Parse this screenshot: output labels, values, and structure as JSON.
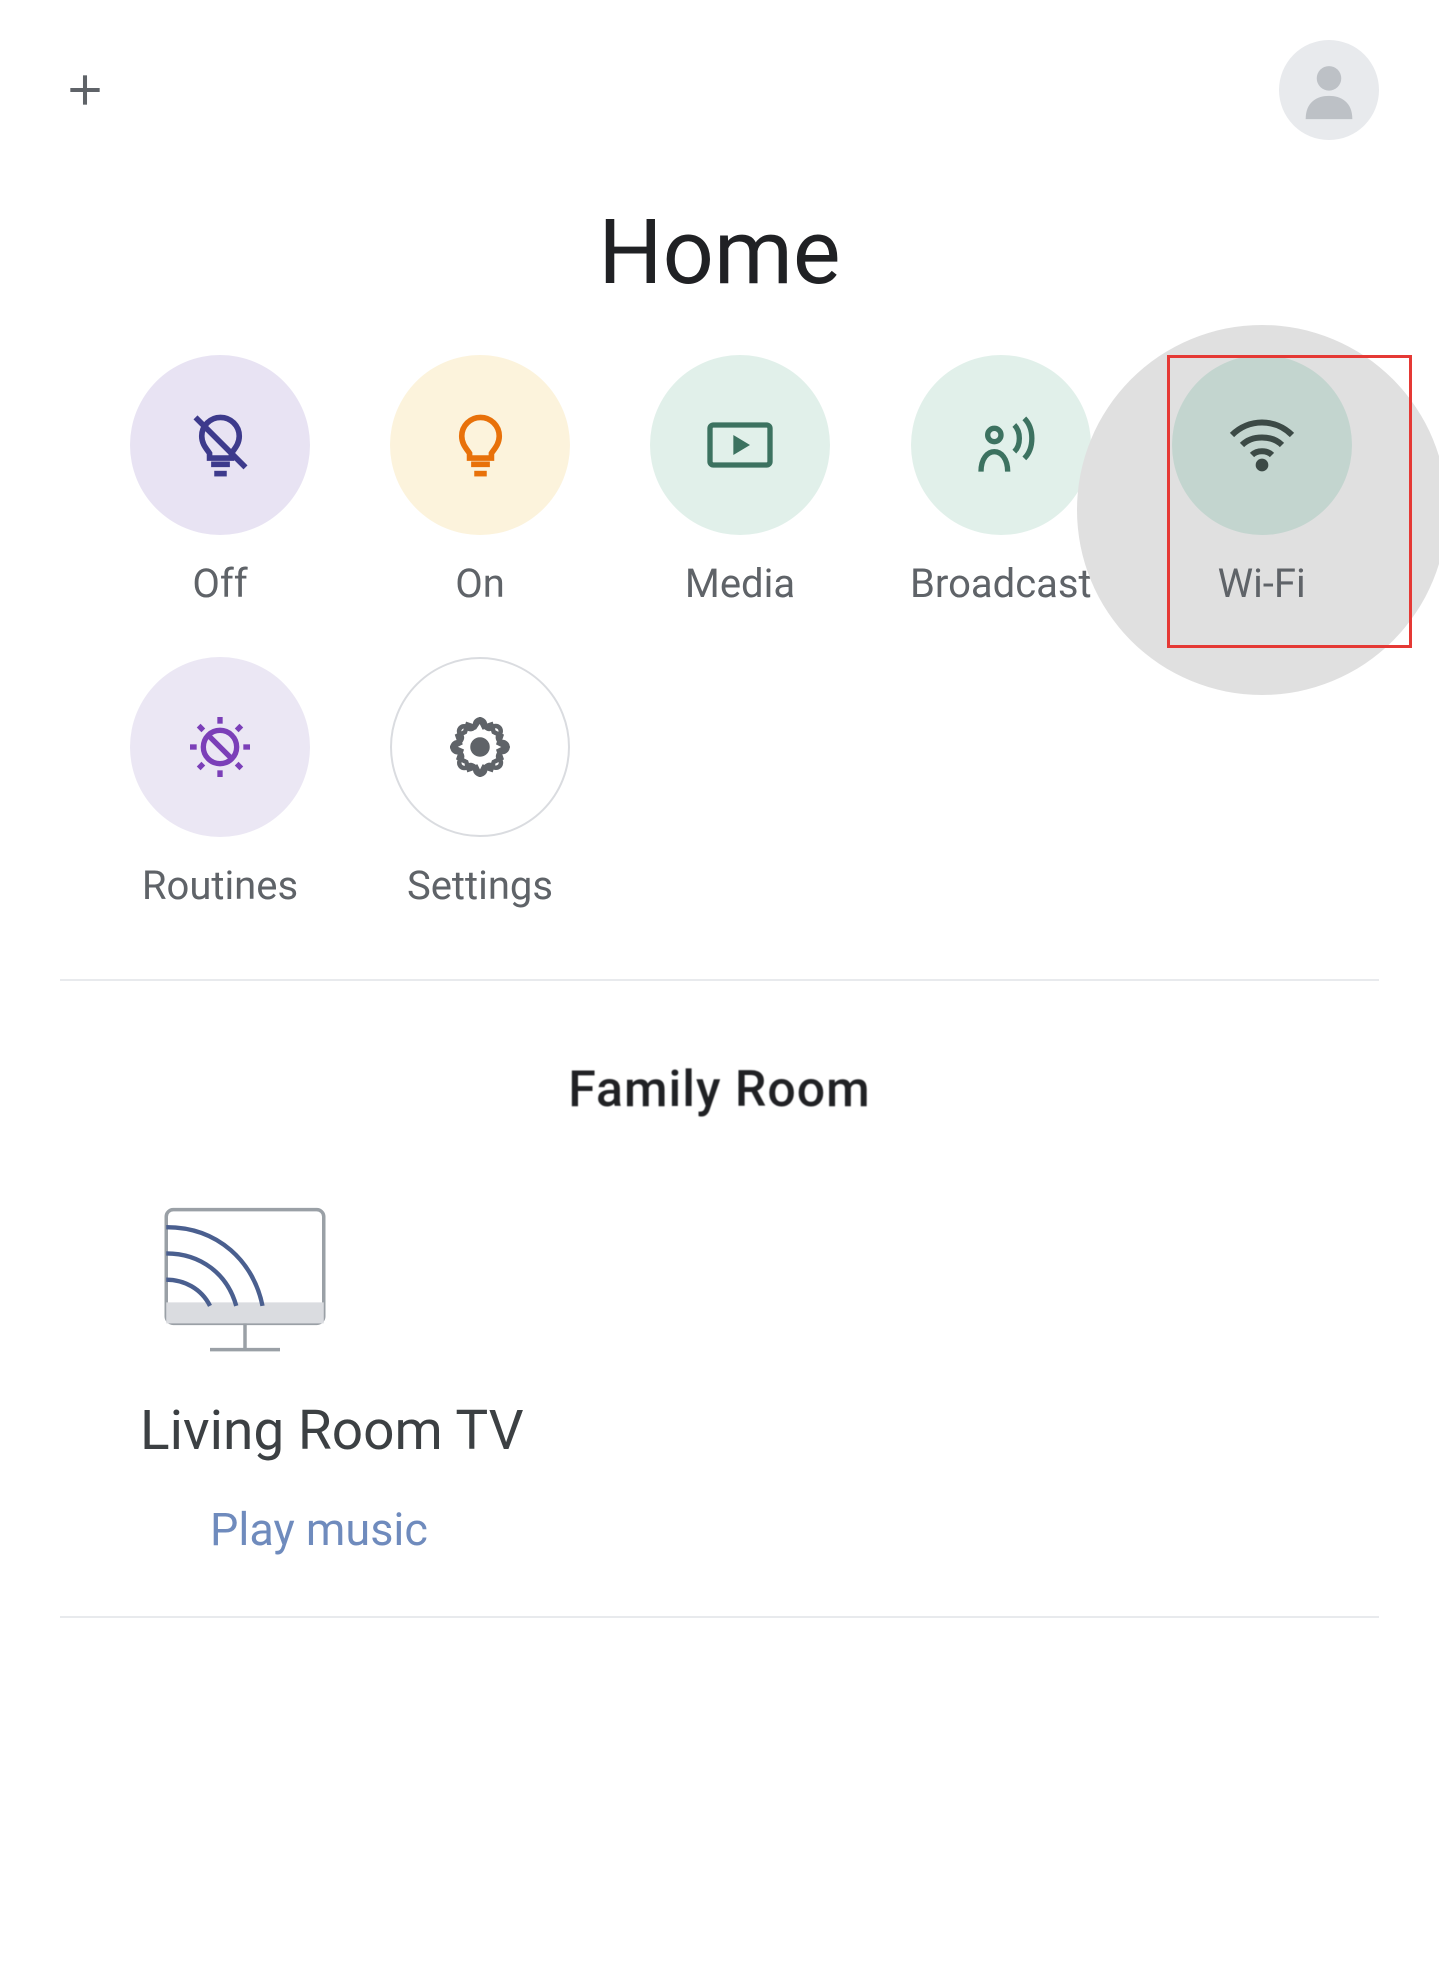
{
  "header": {
    "title": "Home"
  },
  "quickActions": {
    "off": {
      "label": "Off"
    },
    "on": {
      "label": "On"
    },
    "media": {
      "label": "Media"
    },
    "broadcast": {
      "label": "Broadcast"
    },
    "wifi": {
      "label": "Wi-Fi"
    },
    "routines": {
      "label": "Routines"
    },
    "settings": {
      "label": "Settings"
    }
  },
  "room": {
    "name": "Family Room"
  },
  "devices": [
    {
      "name": "Living Room TV",
      "action": "Play music"
    }
  ],
  "icons": {
    "add": "plus-icon",
    "avatar": "person-icon",
    "off": "lightbulb-off-icon",
    "on": "lightbulb-on-icon",
    "media": "play-media-icon",
    "broadcast": "broadcast-icon",
    "wifi": "wifi-icon",
    "routines": "routines-icon",
    "settings": "gear-icon",
    "cast": "cast-tv-icon"
  },
  "colors": {
    "accent_purple": "#6750a4",
    "accent_orange": "#e8710a",
    "accent_teal": "#1e8e3e",
    "text_primary": "#202124",
    "text_secondary": "#5f6368",
    "link": "#6f8bbd",
    "highlight_red": "#e53935"
  }
}
